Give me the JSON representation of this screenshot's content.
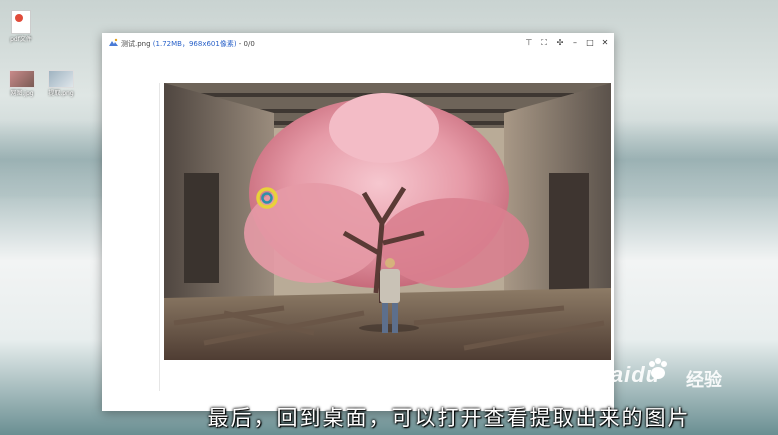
{
  "desktop": {
    "icons": [
      {
        "label": "pdf文件"
      },
      {
        "label": "网图.jpg"
      },
      {
        "label": "提取.png"
      }
    ]
  },
  "window": {
    "title_prefix": "测试.png",
    "title_link": "(1.72MB，968x601像素)",
    "title_suffix": "- 0/0",
    "controls": [
      "pin",
      "fit",
      "fullscreen",
      "minimize",
      "maximize",
      "close"
    ]
  },
  "caption": "最后，回到桌面，可以打开查看提取出来的图片",
  "watermark": {
    "brand": "Baidu",
    "cn": "经验"
  },
  "colors": {
    "accent": "#2a62c9",
    "cursor_ring": "#e8d23a"
  }
}
